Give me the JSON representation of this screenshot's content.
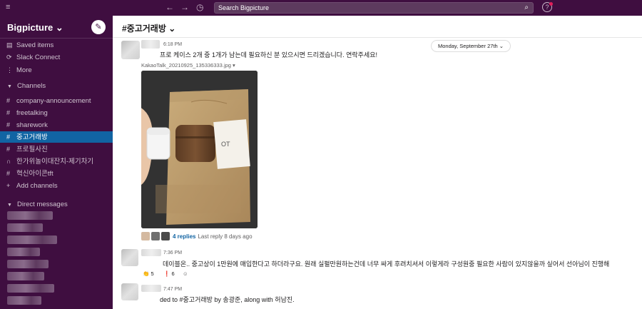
{
  "topbar": {
    "search_placeholder": "Search Bigpicture",
    "menu_icon": "≡",
    "back_icon": "←",
    "forward_icon": "→",
    "history_icon": "◷",
    "search_icon": "⌕",
    "help_icon": "?"
  },
  "sidebar": {
    "workspace_name": "Bigpicture ⌄",
    "compose_icon": "✎",
    "nav": [
      {
        "icon": "▤",
        "label": "Saved items"
      },
      {
        "icon": "⟳",
        "label": "Slack Connect"
      },
      {
        "icon": "⋮",
        "label": "More"
      }
    ],
    "channels_header": "Channels",
    "channels": [
      {
        "icon": "#",
        "label": "company-announcement"
      },
      {
        "icon": "#",
        "label": "freetalking"
      },
      {
        "icon": "#",
        "label": "sharework"
      },
      {
        "icon": "#",
        "label": "중고거래방"
      },
      {
        "icon": "#",
        "label": "프로필사진"
      },
      {
        "icon": "∩",
        "label": "한가위놀이대잔치-제기차기"
      },
      {
        "icon": "#",
        "label": "혁신아이콘tft"
      },
      {
        "icon": "+",
        "label": "Add channels"
      }
    ],
    "active_channel_index": 3,
    "dm_header": "Direct messages"
  },
  "channel_header": {
    "title": "#중고거래방 ⌄"
  },
  "messages": {
    "date_divider": "Monday, September 27th ⌄",
    "msg1": {
      "time": "6:18 PM",
      "text": "프로 케이스 2개 중 1개가 남는데 필요하신 분 있으시면 드리겠습니다. 연락주세요!",
      "file_name": "KakaoTalk_20210925_135336333.jpg ▾",
      "replies_link": "4 replies",
      "replies_meta": "Last reply 8 days ago"
    },
    "msg2": {
      "time": "7:36 PM",
      "text": "데이블온.. 중고상이 1만원에 매입한다고 하더라구요. 원래 실펄만원하는건데 너무 싸게 후려치셔서 이렇게라 구성원중 필요한 사람이 있지않을까 싶어서 선아님이 진행해",
      "reactions": [
        {
          "emoji": "👏",
          "count": "5"
        },
        {
          "emoji": "❗",
          "count": "6"
        },
        {
          "emoji": "☺",
          "count": ""
        }
      ]
    },
    "msg3": {
      "time": "7:47 PM",
      "text": "ded to #중고거래방 by 송광준, along with 허남진."
    }
  }
}
